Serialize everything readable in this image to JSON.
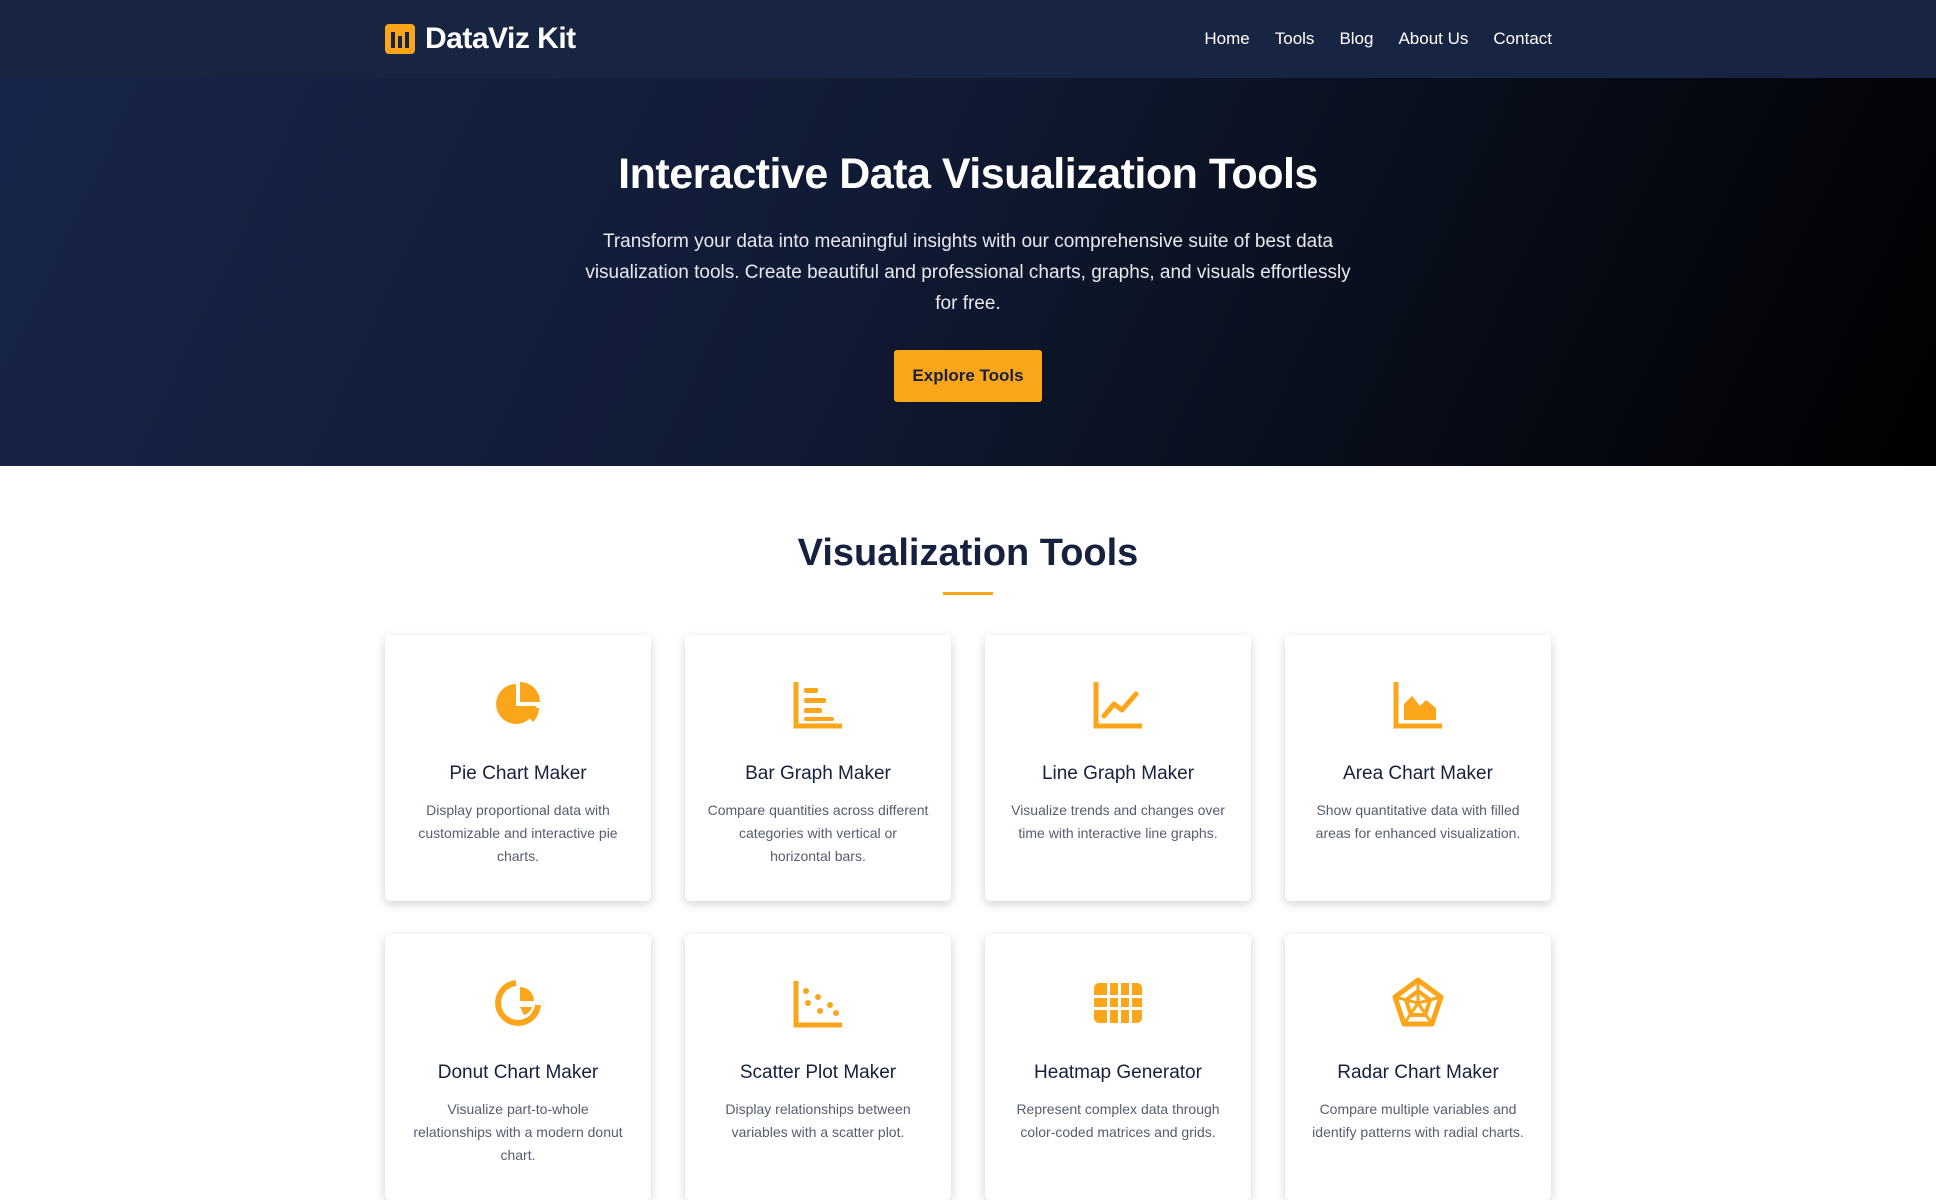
{
  "brand": {
    "name": "DataViz Kit",
    "icon": "bar-chart-logo-icon",
    "accent": "#fba51a"
  },
  "nav": {
    "items": [
      "Home",
      "Tools",
      "Blog",
      "About Us",
      "Contact"
    ]
  },
  "hero": {
    "title": "Interactive Data Visualization Tools",
    "subtitle": "Transform your data into meaningful insights with our comprehensive suite of best data visualization tools. Create beautiful and professional charts, graphs, and visuals effortlessly for free.",
    "cta": "Explore Tools"
  },
  "tools_section": {
    "title": "Visualization Tools",
    "cards": [
      {
        "title": "Pie Chart Maker",
        "desc": "Display proportional data with customizable and interactive pie charts.",
        "icon": "pie-chart-icon"
      },
      {
        "title": "Bar Graph Maker",
        "desc": "Compare quantities across different categories with vertical or horizontal bars.",
        "icon": "bar-chart-icon"
      },
      {
        "title": "Line Graph Maker",
        "desc": "Visualize trends and changes over time with interactive line graphs.",
        "icon": "line-chart-icon"
      },
      {
        "title": "Area Chart Maker",
        "desc": "Show quantitative data with filled areas for enhanced visualization.",
        "icon": "area-chart-icon"
      },
      {
        "title": "Donut Chart Maker",
        "desc": "Visualize part-to-whole relationships with a modern donut chart.",
        "icon": "donut-chart-icon"
      },
      {
        "title": "Scatter Plot Maker",
        "desc": "Display relationships between variables with a scatter plot.",
        "icon": "scatter-plot-icon"
      },
      {
        "title": "Heatmap Generator",
        "desc": "Represent complex data through color-coded matrices and grids.",
        "icon": "heatmap-grid-icon"
      },
      {
        "title": "Radar Chart Maker",
        "desc": "Compare multiple variables and identify patterns with radial charts.",
        "icon": "radar-chart-icon"
      }
    ]
  }
}
